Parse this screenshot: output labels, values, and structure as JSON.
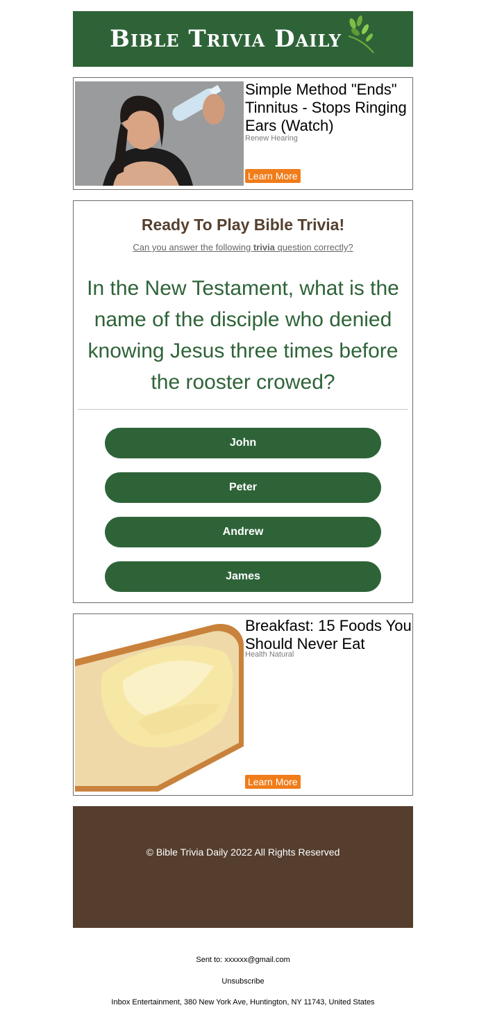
{
  "header": {
    "logo_text": "Bible Trivia Daily",
    "brand_color": "#2e6338"
  },
  "ad_top": {
    "title": "Simple Method \"Ends\" Tinnitus - Stops Ringing Ears (Watch)",
    "source": "Renew Hearing",
    "button": "Learn More",
    "image": "woman-holding-water-bottle-to-ear"
  },
  "trivia": {
    "title": "Ready To Play Bible Trivia!",
    "subtitle_pre": "Can you answer the following ",
    "subtitle_bold": "trivia",
    "subtitle_post": " question correctly?",
    "question": "In the New Testament, what is the name of the disciple who denied knowing Jesus three times before the rooster crowed?",
    "answers": [
      "John",
      "Peter",
      "Andrew",
      "James"
    ]
  },
  "ad_bottom": {
    "title": "Breakfast: 15 Foods You Should Never Eat",
    "source": "Health Natural",
    "button": "Learn More",
    "image": "buttered-toast"
  },
  "footer": {
    "copyright": "© Bible Trivia Daily 2022 All Rights Reserved",
    "color": "#553e2e"
  },
  "fine_print": {
    "sent_to": "Sent to: xxxxxx@gmail.com",
    "unsubscribe": "Unsubscribe",
    "address": "Inbox Entertainment, 380 New York Ave, Huntington, NY 11743, United States"
  },
  "colors": {
    "accent_button": "#f07c1a",
    "answer_button": "#2e6338"
  }
}
